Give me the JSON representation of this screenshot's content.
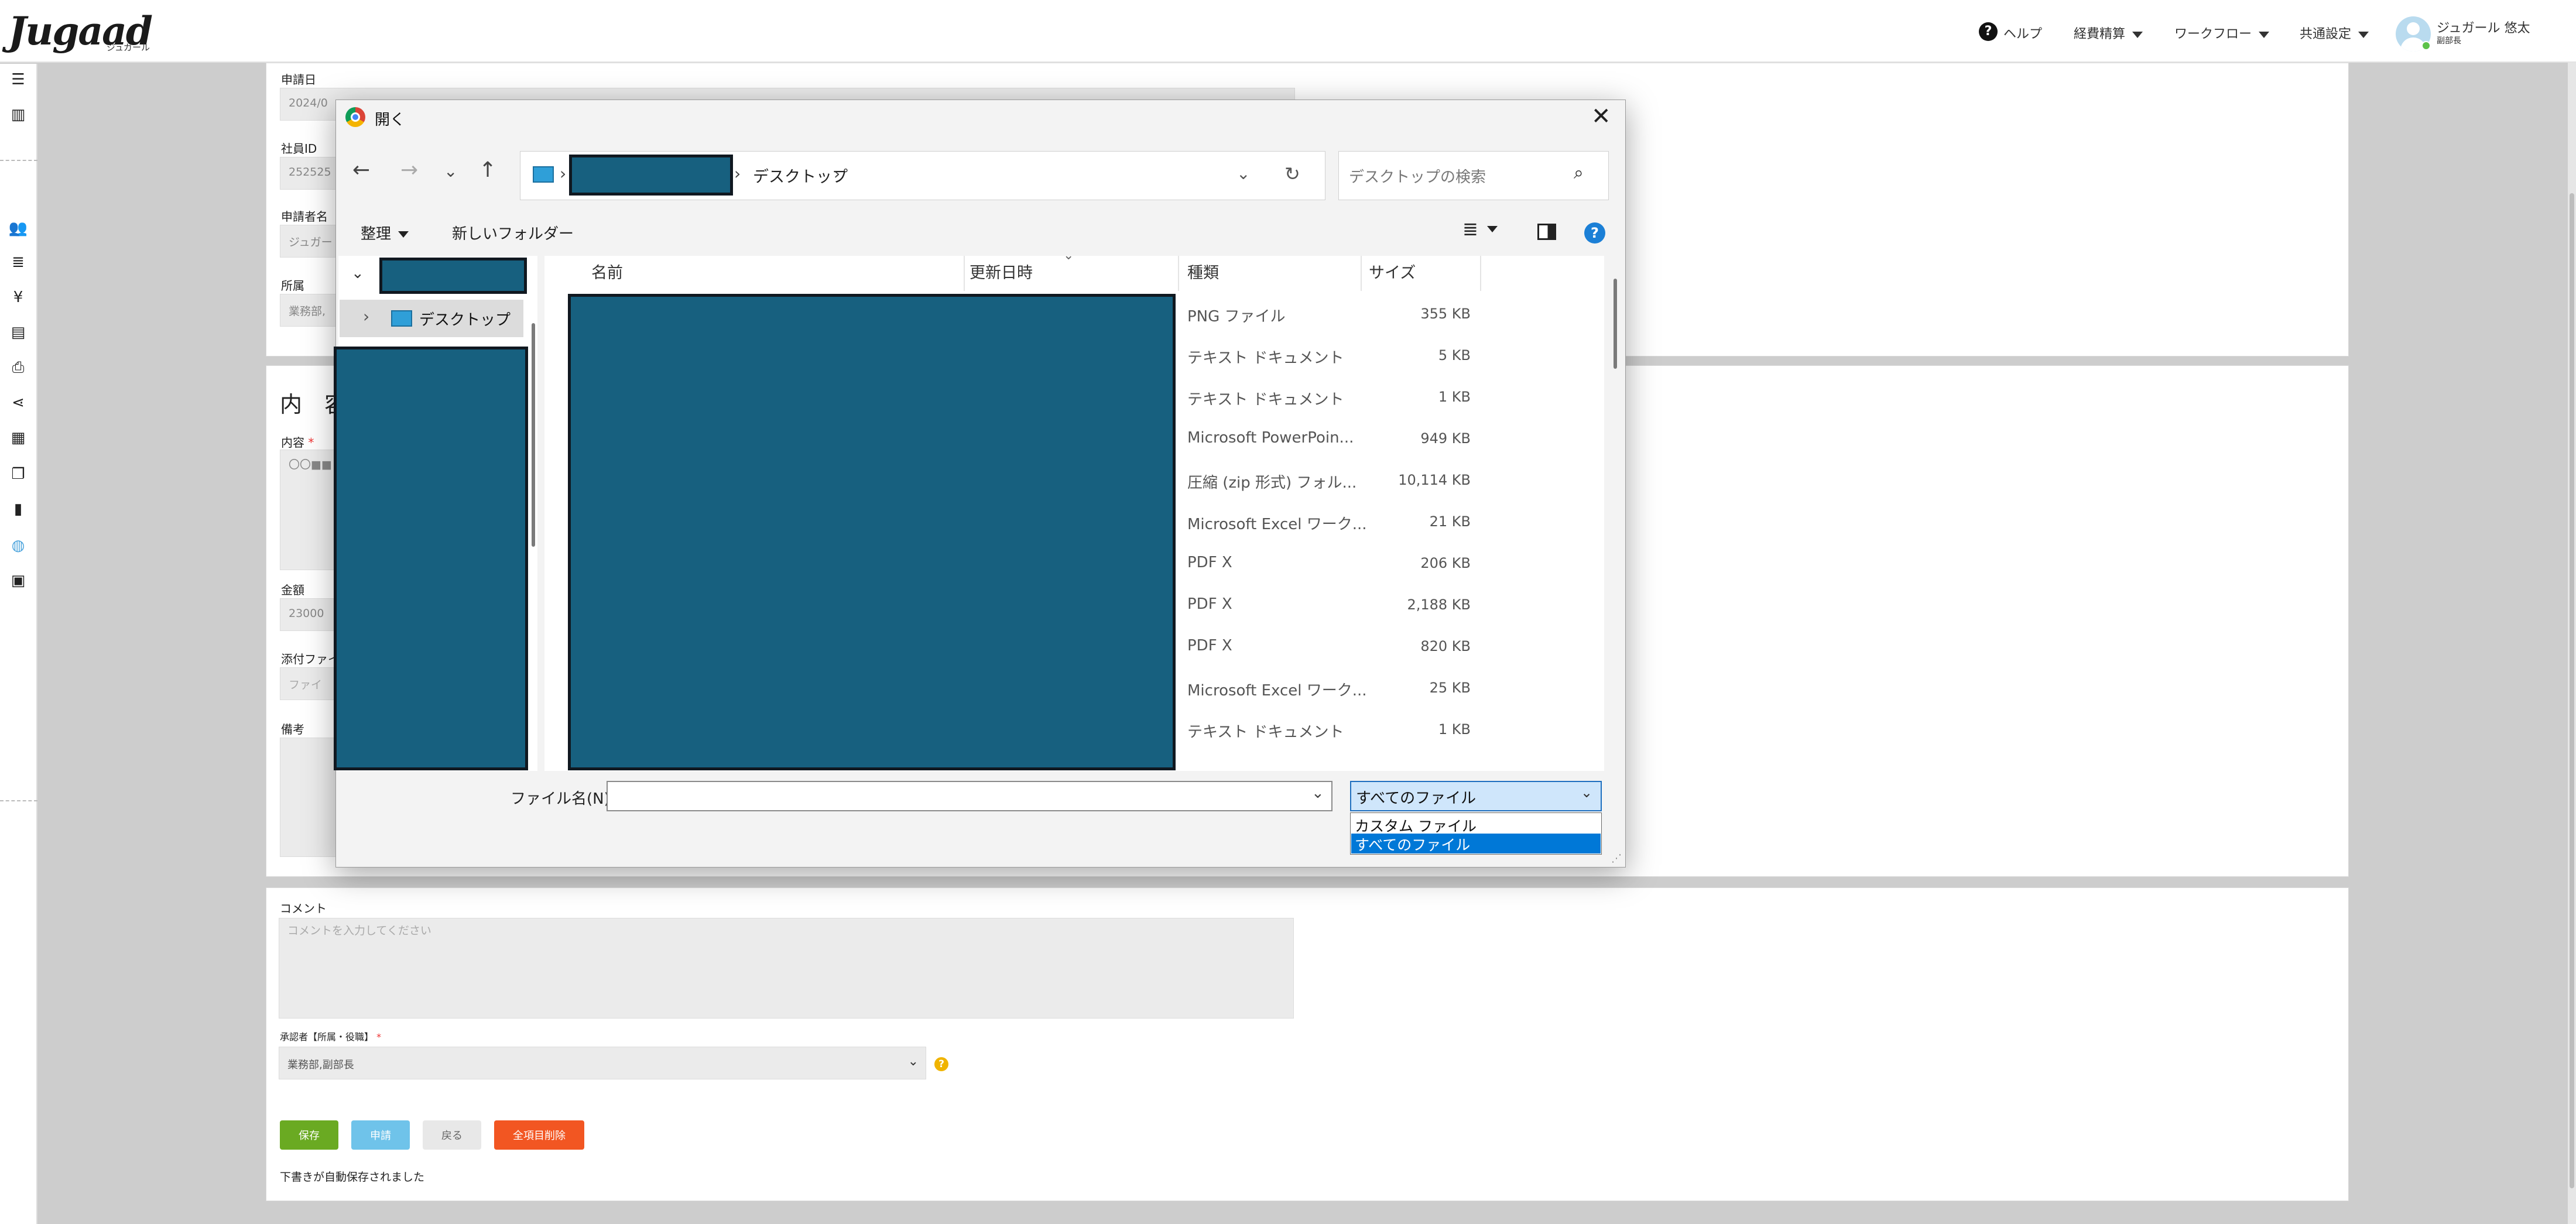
{
  "header": {
    "logo": "Jugaad",
    "logo_sub": "ジュガール",
    "help": "ヘルプ",
    "menu_keihi": "経費精算",
    "menu_workflow": "ワークフロー",
    "menu_common": "共通設定",
    "user_name": "ジュガール 悠太",
    "user_role": "副部長"
  },
  "form": {
    "date_label": "申請日",
    "date_value": "2024/0",
    "empid_label": "社員ID",
    "empid_value": "252525",
    "applicant_label": "申請者名",
    "applicant_value": "ジュガー",
    "dept_label": "所属",
    "dept_value": "業務部,",
    "section_title": "内　容",
    "content_label": "内容",
    "required_mark": "*",
    "content_value": "〇〇■■",
    "amount_label": "金額",
    "amount_value": "23000",
    "attach_label": "添付ファイ",
    "attach_value": "ファイ",
    "memo_label": "備考",
    "comment_label": "コメント",
    "comment_placeholder": "コメントを入力してください",
    "approver_label": "承認者【所属・役職】",
    "approver_value": "業務部,副部長",
    "btn_save": "保存",
    "btn_apply": "申請",
    "btn_back": "戻る",
    "btn_clear": "全項目削除",
    "autosave_note": "下書きが自動保存されました"
  },
  "dialog": {
    "title": "開く",
    "breadcrumb_current": "デスクトップ",
    "breadcrumb_sep": "›",
    "search_placeholder": "デスクトップの検索",
    "organize": "整理",
    "new_folder": "新しいフォルダー",
    "tree_desktop": "デスクトップ",
    "columns": {
      "name": "名前",
      "modified": "更新日時",
      "type": "種類",
      "size": "サイズ"
    },
    "files": [
      {
        "type": "PNG ファイル",
        "size": "355 KB"
      },
      {
        "type": "テキスト ドキュメント",
        "size": "5 KB"
      },
      {
        "type": "テキスト ドキュメント",
        "size": "1 KB"
      },
      {
        "type": "Microsoft PowerPoin...",
        "size": "949 KB"
      },
      {
        "type": "圧縮 (zip 形式) フォル...",
        "size": "10,114 KB"
      },
      {
        "type": "Microsoft Excel ワーク...",
        "size": "21 KB"
      },
      {
        "type": "PDF X",
        "size": "206 KB"
      },
      {
        "type": "PDF X",
        "size": "2,188 KB"
      },
      {
        "type": "PDF X",
        "size": "820 KB"
      },
      {
        "type": "Microsoft Excel ワーク...",
        "size": "25 KB"
      },
      {
        "type": "テキスト ドキュメント",
        "size": "1 KB"
      }
    ],
    "filename_label": "ファイル名(N):",
    "filetype_selected": "すべてのファイル",
    "filetype_options": [
      "カスタム ファイル",
      "すべてのファイル"
    ]
  },
  "colors": {
    "accent_blue": "#0078d7",
    "redaction": "#17607f",
    "save_green": "#6aaa22",
    "apply_blue": "#6fc3ea",
    "clear_orange": "#f25622"
  }
}
